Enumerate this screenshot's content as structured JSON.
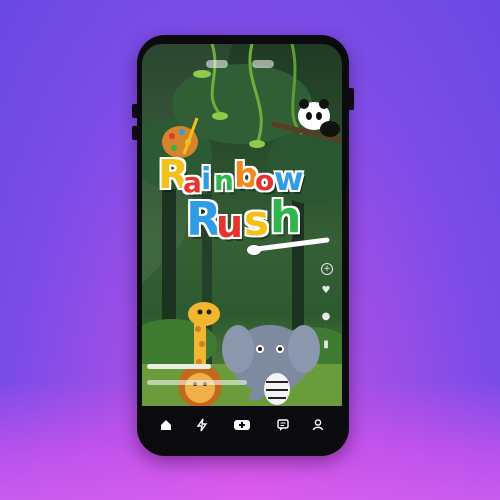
{
  "title": {
    "word1": [
      "R",
      "a",
      "i",
      "n",
      "b",
      "o",
      "w"
    ],
    "word2": [
      "R",
      "u",
      "s",
      "h"
    ],
    "colors1": [
      "#f2c21b",
      "#e7332d",
      "#2e9de6",
      "#2fb54a",
      "#f28a1b",
      "#e7332d",
      "#2e9de6"
    ],
    "colors2": [
      "#2e9de6",
      "#e7332d",
      "#f2c21b",
      "#2fb54a"
    ]
  },
  "side_actions": [
    "add-icon",
    "heart-icon",
    "comment-icon",
    "bookmark-icon"
  ],
  "nav": [
    "home-icon",
    "bolt-icon",
    "create-icon",
    "inbox-icon",
    "profile-icon"
  ],
  "progress": {
    "row1_fraction": 0.6,
    "row2_fraction": 0.1
  },
  "colors": {
    "background": "#8a4ce6",
    "phone": "#0b0b0f",
    "jungle": "#2e5a30"
  }
}
